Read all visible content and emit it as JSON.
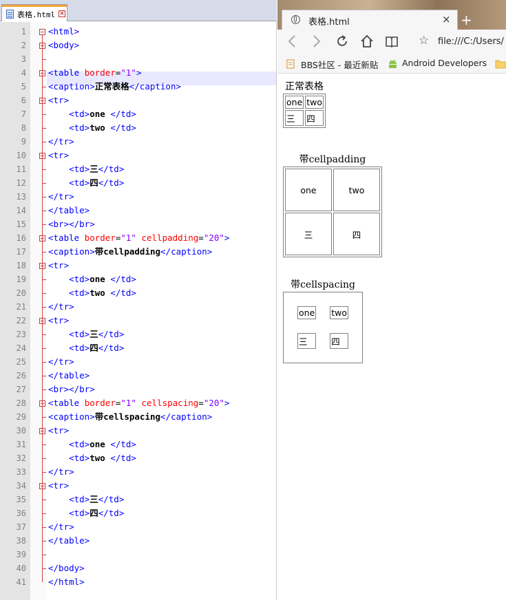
{
  "editor": {
    "tab_label": "表格.html",
    "lines": [
      {
        "n": "1",
        "segs": [
          [
            "tg",
            "<html>"
          ]
        ]
      },
      {
        "n": "2",
        "segs": [
          [
            "tg",
            "<body>"
          ]
        ]
      },
      {
        "n": "3",
        "segs": []
      },
      {
        "n": "4",
        "segs": [
          [
            "tg",
            "<table "
          ],
          [
            "at",
            "border"
          ],
          [
            "eq",
            "="
          ],
          [
            "vl",
            "\"1\""
          ],
          [
            "tg",
            ">"
          ]
        ]
      },
      {
        "n": "5",
        "segs": [
          [
            "tg",
            "<caption>"
          ],
          [
            "tx",
            "正常表格"
          ],
          [
            "tg",
            "</caption>"
          ]
        ]
      },
      {
        "n": "6",
        "segs": [
          [
            "tg",
            "<tr>"
          ]
        ]
      },
      {
        "n": "7",
        "segs": [
          [
            "tg",
            "    <td>"
          ],
          [
            "tx",
            "one "
          ],
          [
            "tg",
            "</td>"
          ]
        ]
      },
      {
        "n": "8",
        "segs": [
          [
            "tg",
            "    <td>"
          ],
          [
            "tx",
            "two "
          ],
          [
            "tg",
            "</td>"
          ]
        ]
      },
      {
        "n": "9",
        "segs": [
          [
            "tg",
            "</tr>"
          ]
        ]
      },
      {
        "n": "10",
        "segs": [
          [
            "tg",
            "<tr>"
          ]
        ]
      },
      {
        "n": "11",
        "segs": [
          [
            "tg",
            "    <td>"
          ],
          [
            "tx",
            "三"
          ],
          [
            "tg",
            "</td>"
          ]
        ]
      },
      {
        "n": "12",
        "segs": [
          [
            "tg",
            "    <td>"
          ],
          [
            "tx",
            "四"
          ],
          [
            "tg",
            "</td>"
          ]
        ]
      },
      {
        "n": "13",
        "segs": [
          [
            "tg",
            "</tr>"
          ]
        ]
      },
      {
        "n": "14",
        "segs": [
          [
            "tg",
            "</table>"
          ]
        ]
      },
      {
        "n": "15",
        "segs": [
          [
            "tg",
            "<br></br>"
          ]
        ]
      },
      {
        "n": "16",
        "segs": [
          [
            "tg",
            "<table "
          ],
          [
            "at",
            "border"
          ],
          [
            "eq",
            "="
          ],
          [
            "vl",
            "\"1\" "
          ],
          [
            "at",
            "cellpadding"
          ],
          [
            "eq",
            "="
          ],
          [
            "vl",
            "\"20\""
          ],
          [
            "tg",
            ">"
          ]
        ]
      },
      {
        "n": "17",
        "segs": [
          [
            "tg",
            "<caption>"
          ],
          [
            "tx",
            "带cellpadding"
          ],
          [
            "tg",
            "</caption>"
          ]
        ]
      },
      {
        "n": "18",
        "segs": [
          [
            "tg",
            "<tr>"
          ]
        ]
      },
      {
        "n": "19",
        "segs": [
          [
            "tg",
            "    <td>"
          ],
          [
            "tx",
            "one "
          ],
          [
            "tg",
            "</td>"
          ]
        ]
      },
      {
        "n": "20",
        "segs": [
          [
            "tg",
            "    <td>"
          ],
          [
            "tx",
            "two "
          ],
          [
            "tg",
            "</td>"
          ]
        ]
      },
      {
        "n": "21",
        "segs": [
          [
            "tg",
            "</tr>"
          ]
        ]
      },
      {
        "n": "22",
        "segs": [
          [
            "tg",
            "<tr>"
          ]
        ]
      },
      {
        "n": "23",
        "segs": [
          [
            "tg",
            "    <td>"
          ],
          [
            "tx",
            "三"
          ],
          [
            "tg",
            "</td>"
          ]
        ]
      },
      {
        "n": "24",
        "segs": [
          [
            "tg",
            "    <td>"
          ],
          [
            "tx",
            "四"
          ],
          [
            "tg",
            "</td>"
          ]
        ]
      },
      {
        "n": "25",
        "segs": [
          [
            "tg",
            "</tr>"
          ]
        ]
      },
      {
        "n": "26",
        "segs": [
          [
            "tg",
            "</table>"
          ]
        ]
      },
      {
        "n": "27",
        "segs": [
          [
            "tg",
            "<br></br>"
          ]
        ]
      },
      {
        "n": "28",
        "segs": [
          [
            "tg",
            "<table "
          ],
          [
            "at",
            "border"
          ],
          [
            "eq",
            "="
          ],
          [
            "vl",
            "\"1\" "
          ],
          [
            "at",
            "cellspacing"
          ],
          [
            "eq",
            "="
          ],
          [
            "vl",
            "\"20\""
          ],
          [
            "tg",
            ">"
          ]
        ]
      },
      {
        "n": "29",
        "segs": [
          [
            "tg",
            "<caption>"
          ],
          [
            "tx",
            "带cellspacing"
          ],
          [
            "tg",
            "</caption>"
          ]
        ]
      },
      {
        "n": "30",
        "segs": [
          [
            "tg",
            "<tr>"
          ]
        ]
      },
      {
        "n": "31",
        "segs": [
          [
            "tg",
            "    <td>"
          ],
          [
            "tx",
            "one "
          ],
          [
            "tg",
            "</td>"
          ]
        ]
      },
      {
        "n": "32",
        "segs": [
          [
            "tg",
            "    <td>"
          ],
          [
            "tx",
            "two "
          ],
          [
            "tg",
            "</td>"
          ]
        ]
      },
      {
        "n": "33",
        "segs": [
          [
            "tg",
            "</tr>"
          ]
        ]
      },
      {
        "n": "34",
        "segs": [
          [
            "tg",
            "<tr>"
          ]
        ]
      },
      {
        "n": "35",
        "segs": [
          [
            "tg",
            "    <td>"
          ],
          [
            "tx",
            "三"
          ],
          [
            "tg",
            "</td>"
          ]
        ]
      },
      {
        "n": "36",
        "segs": [
          [
            "tg",
            "    <td>"
          ],
          [
            "tx",
            "四"
          ],
          [
            "tg",
            "</td>"
          ]
        ]
      },
      {
        "n": "37",
        "segs": [
          [
            "tg",
            "</tr>"
          ]
        ]
      },
      {
        "n": "38",
        "segs": [
          [
            "tg",
            "</table>"
          ]
        ]
      },
      {
        "n": "39",
        "segs": []
      },
      {
        "n": "40",
        "segs": [
          [
            "tg",
            "</body>"
          ]
        ]
      },
      {
        "n": "41",
        "segs": [
          [
            "tg",
            "</html>"
          ]
        ]
      }
    ]
  },
  "browser": {
    "tab_title": "表格.html",
    "tab_close": "×",
    "new_tab": "+",
    "url": "file:///C:/Users/",
    "bookmarks": [
      "BBS社区 - 最近新贴",
      "Android Developers"
    ],
    "tables": [
      {
        "caption": "正常表格",
        "cells": [
          [
            "one",
            "two"
          ],
          [
            "三",
            "四"
          ]
        ]
      },
      {
        "caption": "带cellpadding",
        "cells": [
          [
            "one",
            "two"
          ],
          [
            "三",
            "四"
          ]
        ]
      },
      {
        "caption": "带cellspacing",
        "cells": [
          [
            "one",
            "two"
          ],
          [
            "三",
            "四"
          ]
        ]
      }
    ]
  }
}
